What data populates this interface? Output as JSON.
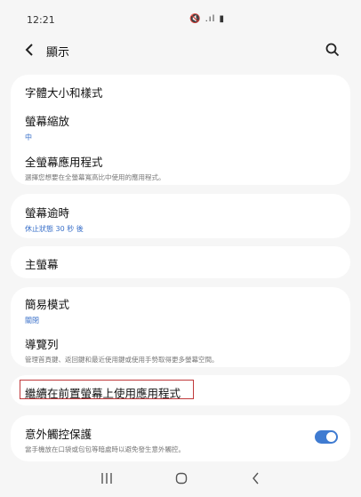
{
  "status_bar": {
    "time": "12:21",
    "icons": "🔇 .ıl ▮"
  },
  "header": {
    "back_icon": "chevron-left",
    "title": "顯示",
    "search_icon": "search"
  },
  "cards": [
    {
      "items": [
        {
          "title": "字體大小和樣式"
        },
        {
          "title": "螢幕縮放",
          "sub": "中"
        },
        {
          "title": "全螢幕應用程式",
          "desc": "選擇您想要在全螢幕寬高比中使用的應用程式。"
        }
      ]
    },
    {
      "items": [
        {
          "title": "螢幕逾時",
          "sub": "休止狀態 30 秒 後"
        }
      ]
    },
    {
      "items": [
        {
          "title": "主螢幕"
        }
      ]
    },
    {
      "items": [
        {
          "title": "簡易模式",
          "sub": "關閉"
        },
        {
          "title": "導覽列",
          "desc": "管理首頁鍵、返回鍵和最近使用鍵或使用手勢取得更多螢幕空間。"
        }
      ]
    },
    {
      "items": [
        {
          "title": "繼續在前置螢幕上使用應用程式"
        }
      ]
    },
    {
      "items": [
        {
          "title": "意外觸控保護",
          "desc": "當手機放在口袋或包包等暗處時以避免發生意外觸控。",
          "toggle": true
        }
      ]
    }
  ],
  "colors": {
    "accent": "#3f7bd1",
    "highlight": "#c0393b",
    "background": "#f6f6f6",
    "card": "#ffffff"
  },
  "nav": {
    "recents_glyph": "|||",
    "home_glyph": "○",
    "back_glyph": "<"
  }
}
